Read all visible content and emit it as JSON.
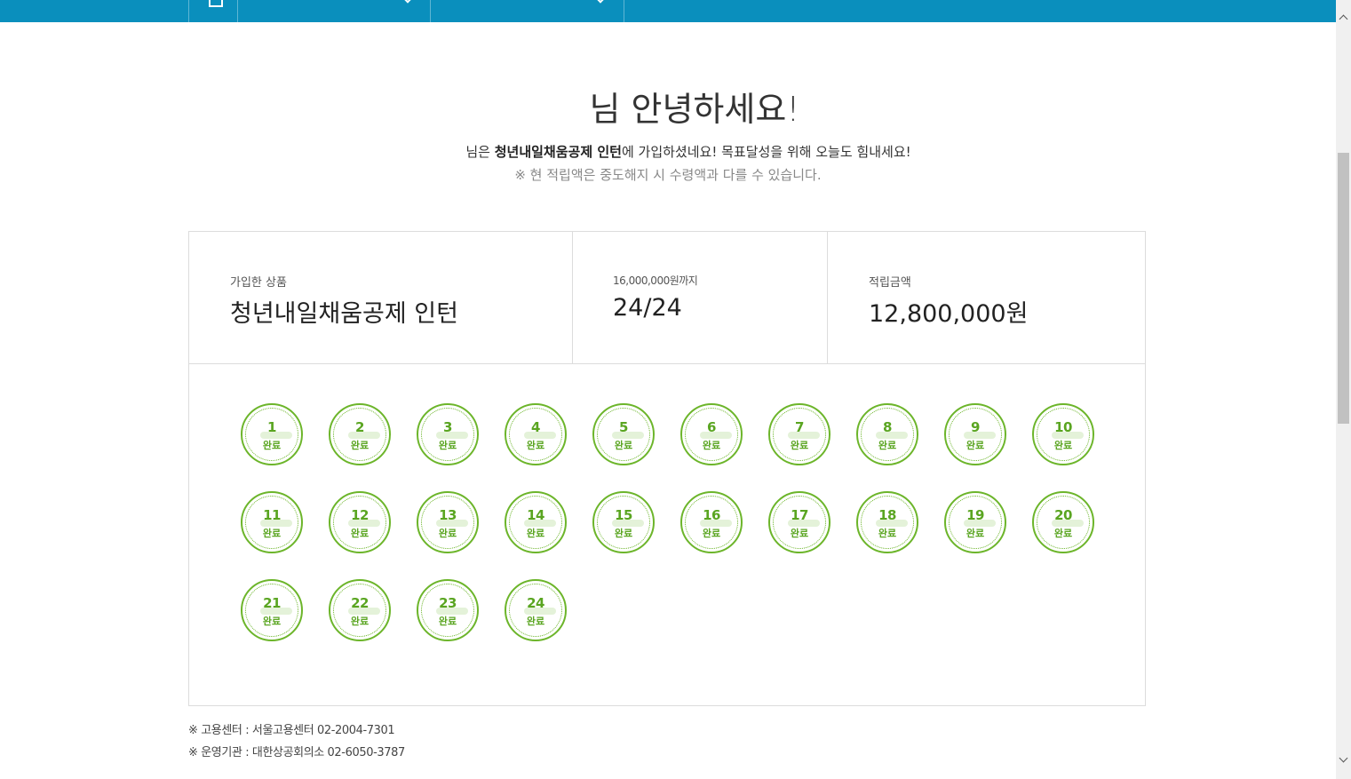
{
  "topnav": {
    "menu1_label": "",
    "menu2_label": ""
  },
  "greeting": {
    "title": "님 안녕하세요!",
    "subtext_prefix": "님은 ",
    "subtext_product": "청년내일채움공제 인턴",
    "subtext_suffix": "에 가입하셨네요! 목표달성을 위해 오늘도 힘내세요!",
    "notice": "※ 현 적립액은 중도해지 시 수령액과 다를 수 있습니다."
  },
  "summary": {
    "product_label": "가입한 상품",
    "product_value": "청년내일채움공제 인턴",
    "goal_label": "16,000,000원까지",
    "goal_value": "24/24",
    "saved_label": "적립금액",
    "saved_value": "12,800,000원"
  },
  "stamps": {
    "status_label": "완료",
    "items": [
      "1",
      "2",
      "3",
      "4",
      "5",
      "6",
      "7",
      "8",
      "9",
      "10",
      "11",
      "12",
      "13",
      "14",
      "15",
      "16",
      "17",
      "18",
      "19",
      "20",
      "21",
      "22",
      "23",
      "24"
    ]
  },
  "footer": {
    "center_note": "※ 고용센터 : 서울고용센터 02-2004-7301",
    "agency_note": "※ 운영기관 : 대한상공회의소 02-6050-3787"
  },
  "colors": {
    "nav_bg": "#0a8fbd",
    "stamp_green": "#6cb52a"
  }
}
